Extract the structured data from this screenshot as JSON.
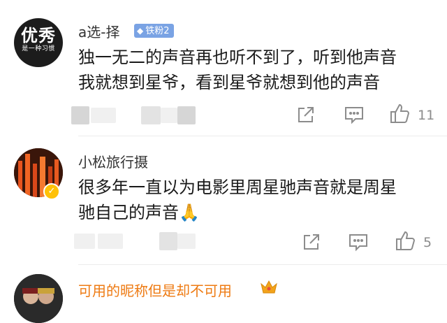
{
  "comments": [
    {
      "avatar_big": "优秀",
      "avatar_small": "是一种习惯",
      "username": "a选-择",
      "fan_badge": "铁粉2",
      "fan_badge_icon": "diamond-icon",
      "text_line1": "独一无二的声音再也听不到了，听到他声音",
      "text_line2": "我就想到星爷，看到星爷就想到他的声音",
      "like_count": "11"
    },
    {
      "username": "小松旅行摄",
      "verified": true,
      "text_line1": "很多年一直以为电影里周星驰声音就是周星",
      "text_line2": "驰自己的声音🙏",
      "like_count": "5"
    },
    {
      "username": "可用的昵称但是却不可用",
      "username_color": "#ee7a12",
      "badge_icon": "crown-icon"
    }
  ],
  "colors": {
    "fan_badge_bg": "#7aa3e4",
    "orange_name": "#ee7a12",
    "action_gray": "#8c8c8c"
  }
}
